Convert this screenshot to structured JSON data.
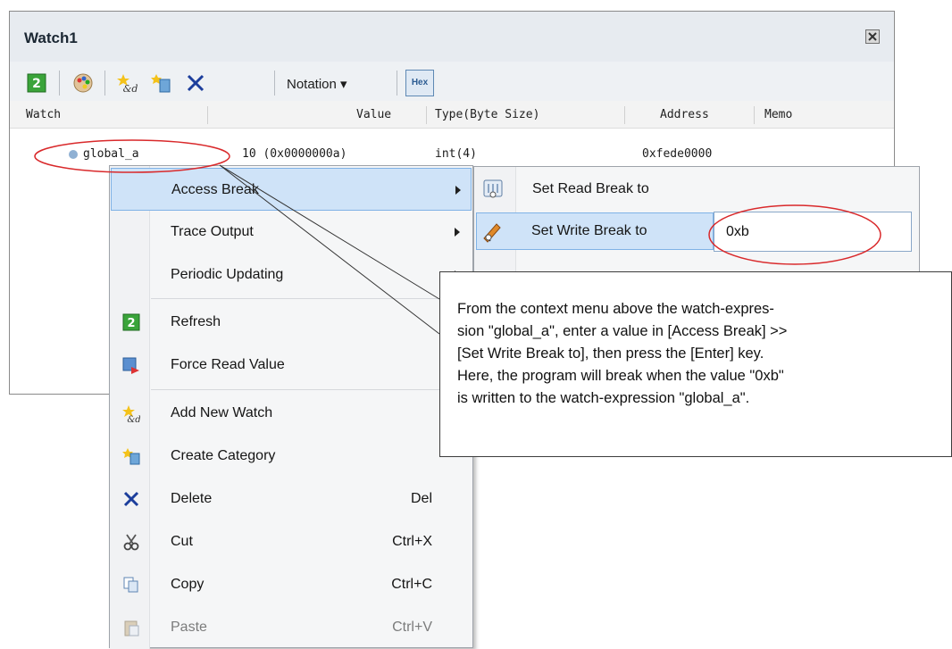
{
  "window": {
    "title": "Watch1"
  },
  "toolbar": {
    "icons": [
      "refresh-icon",
      "palette-icon",
      "add-watch-icon",
      "create-category-icon",
      "delete-icon"
    ],
    "notation_label": "Notation ▾",
    "hex_label": "Hex"
  },
  "grid": {
    "columns": [
      "Watch",
      "Value",
      "Type(Byte Size)",
      "Address",
      "Memo"
    ],
    "rows": [
      {
        "watch": "global_a",
        "value": "10 (0x0000000a)",
        "type": "int(4)",
        "address": "0xfede0000",
        "memo": ""
      }
    ]
  },
  "context_menu": {
    "items": [
      {
        "label": "Access Break",
        "shortcut": "",
        "submenu": true,
        "icon": ""
      },
      {
        "label": "Trace Output",
        "shortcut": "",
        "submenu": true,
        "icon": ""
      },
      {
        "label": "Periodic Updating",
        "shortcut": "",
        "submenu": true,
        "icon": ""
      },
      {
        "label": "Refresh",
        "shortcut": "",
        "submenu": false,
        "icon": "refresh-icon"
      },
      {
        "label": "Force Read Value",
        "shortcut": "",
        "submenu": false,
        "icon": "force-read-icon"
      },
      {
        "label": "Add New Watch",
        "shortcut": "",
        "submenu": false,
        "icon": "add-watch-icon"
      },
      {
        "label": "Create Category",
        "shortcut": "",
        "submenu": false,
        "icon": "create-category-icon"
      },
      {
        "label": "Delete",
        "shortcut": "Del",
        "submenu": false,
        "icon": "delete-icon"
      },
      {
        "label": "Cut",
        "shortcut": "Ctrl+X",
        "submenu": false,
        "icon": "cut-icon"
      },
      {
        "label": "Copy",
        "shortcut": "Ctrl+C",
        "submenu": false,
        "icon": "copy-icon"
      },
      {
        "label": "Paste",
        "shortcut": "Ctrl+V",
        "submenu": false,
        "icon": "paste-icon",
        "disabled": true
      }
    ]
  },
  "submenu": {
    "items": [
      {
        "label": "Set Read Break to",
        "icon": "read-break-icon"
      },
      {
        "label": "Set Write Break to",
        "icon": "write-break-icon",
        "input_value": "0xb"
      }
    ]
  },
  "callout": {
    "text": "From the context menu above the watch-expres-\nsion \"global_a\", enter a value in [Access Break] >>\n[Set Write Break to], then press the [Enter] key.\nHere, the program will break when the value \"0xb\"\nis written to the watch-expression \"global_a\"."
  },
  "colors": {
    "highlight": "#cfe3f8",
    "highlight_border": "#7fb2e6",
    "annotation_red": "#d9292b"
  }
}
